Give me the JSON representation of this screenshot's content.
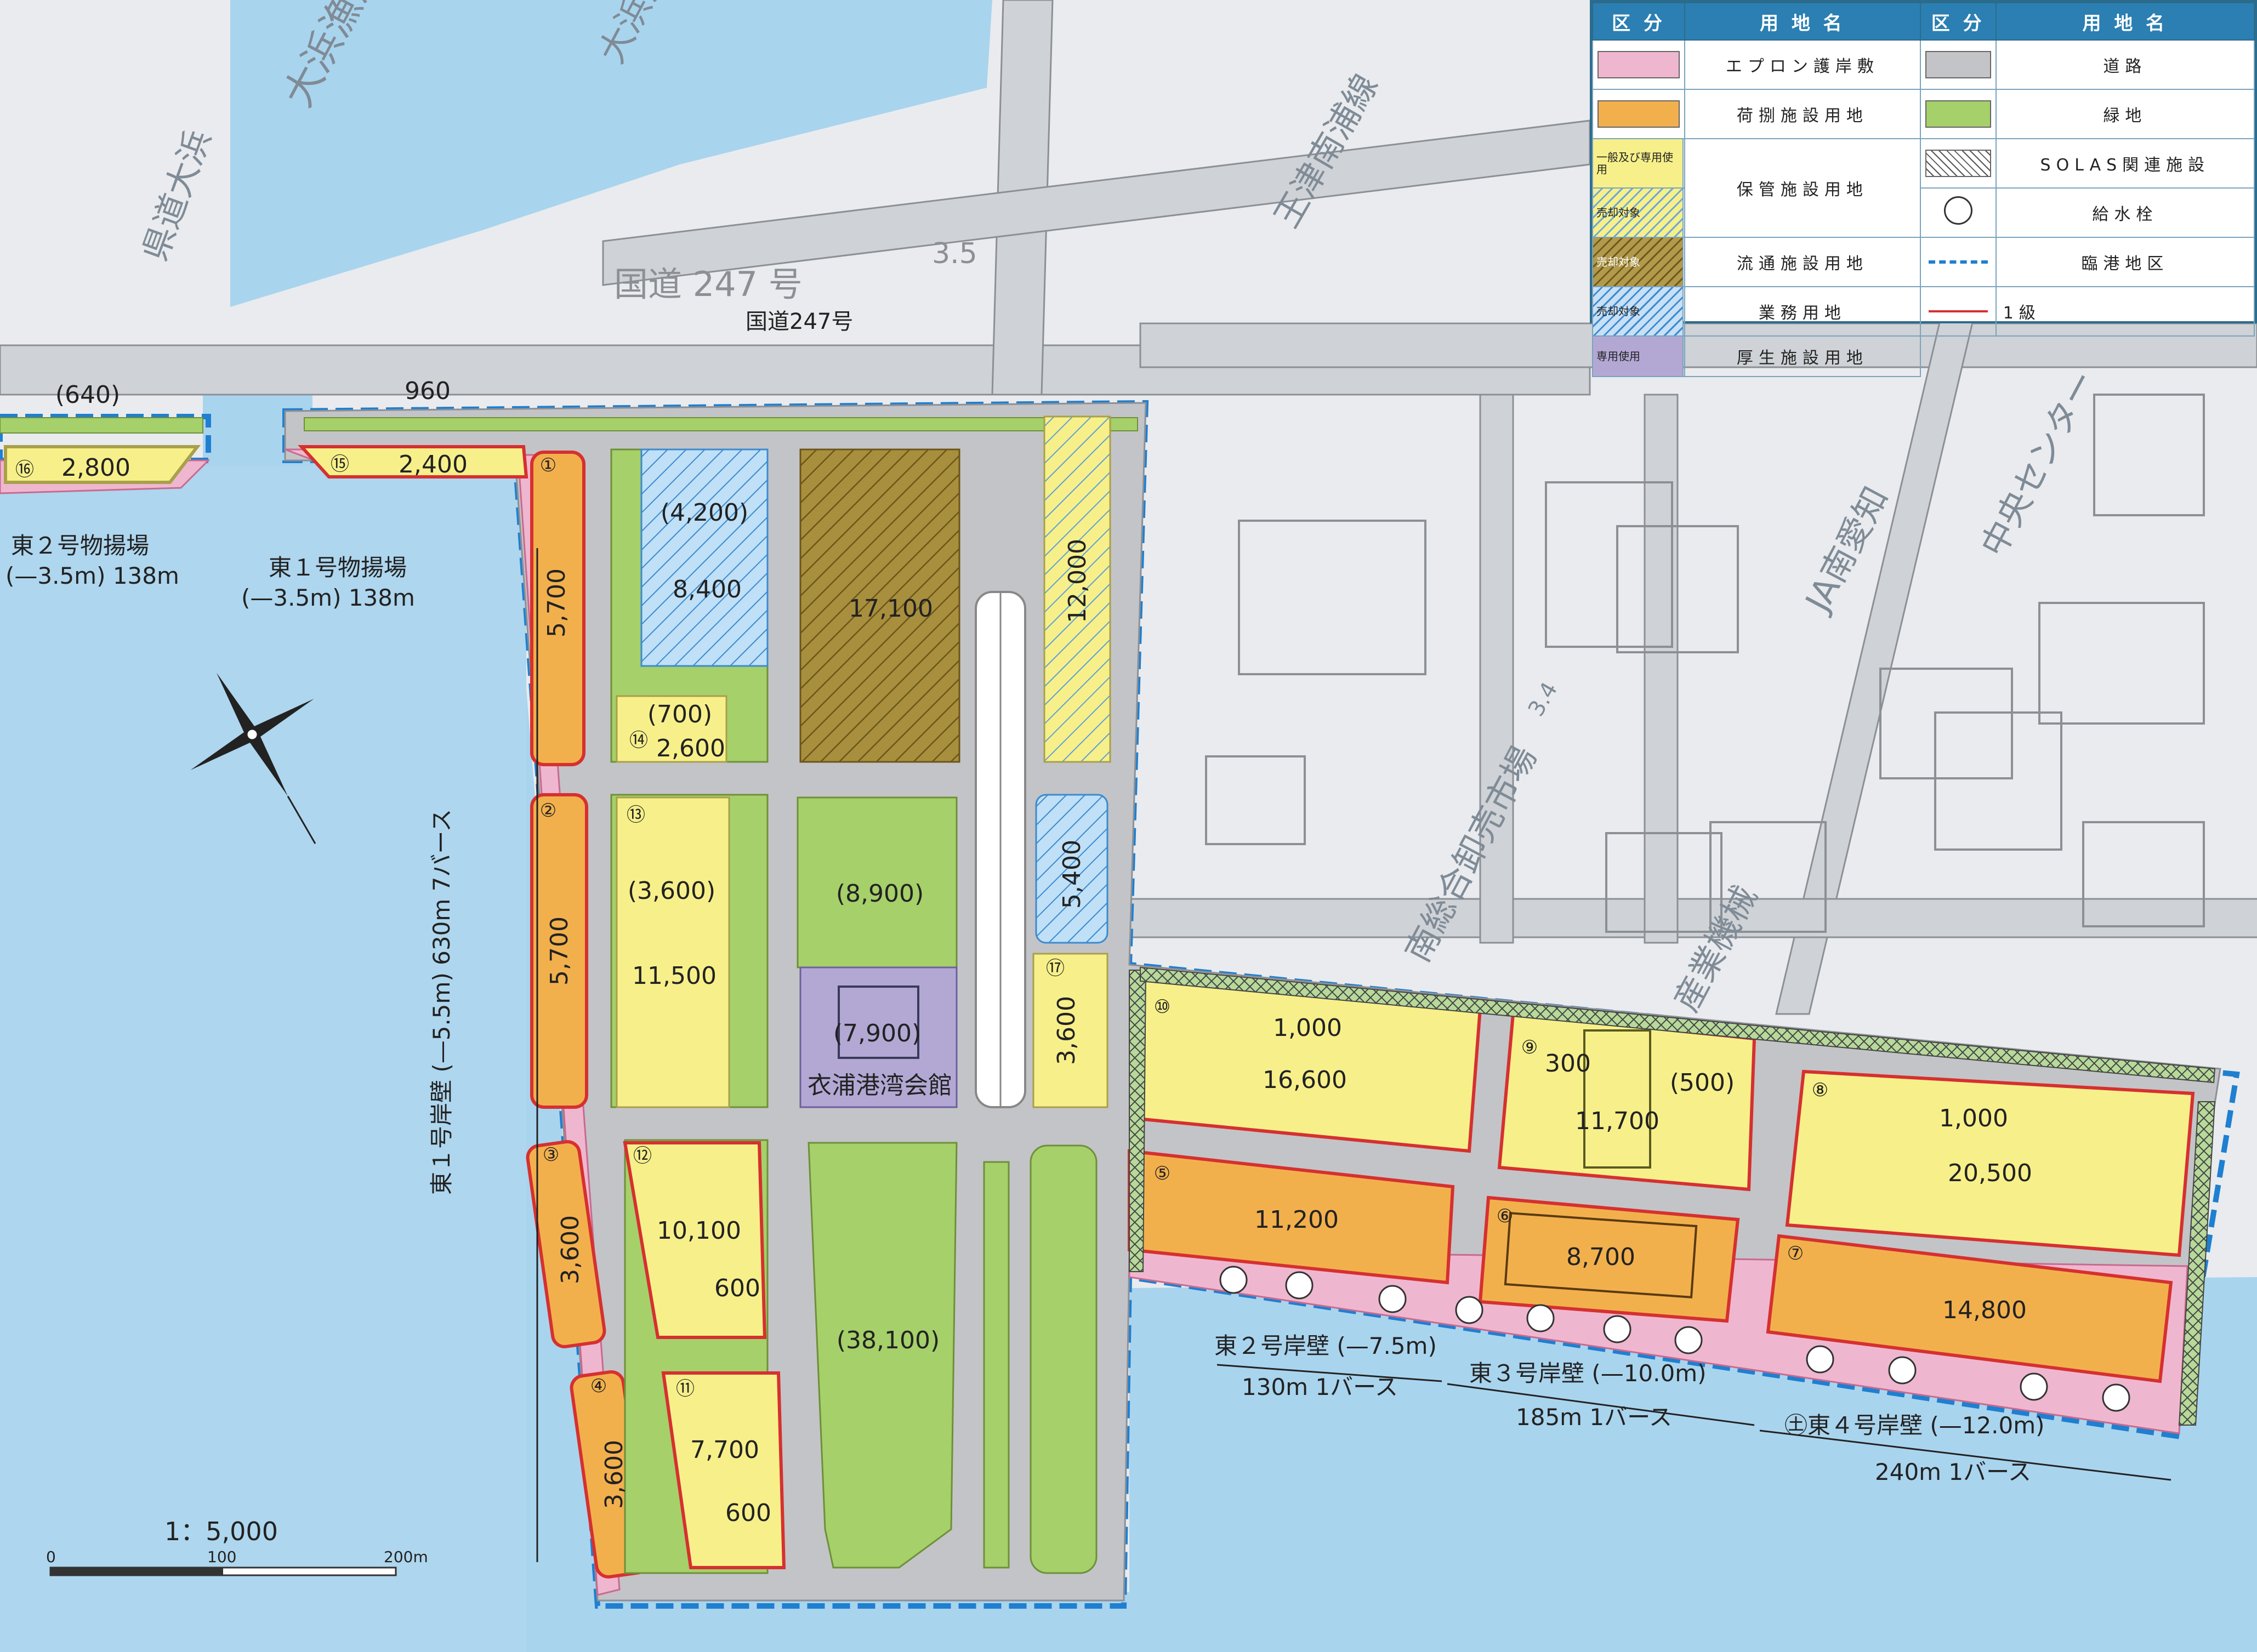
{
  "map": {
    "road_label": "国道247号",
    "road_label_base": "国道 247 号",
    "road_number_base": "3.5",
    "base_labels": [
      "大浜漁港",
      "大浜漁協",
      "県道大浜",
      "王津南浦線",
      "南総合卸売市場",
      "JA南愛知",
      "中央センター",
      "産業機械",
      "3.4"
    ],
    "scale_title": "1：5,000",
    "scale_ticks": [
      "0",
      "100",
      "200m"
    ],
    "colors": {
      "sea": "#a9d4ee",
      "base": "#e9ebee",
      "road": "#c3c4c7",
      "apron": "#efb7cf",
      "cargo": "#f2b04d",
      "storage": "#f7f08a",
      "green": "#a5d06a",
      "welfare": "#b3a8d4",
      "harbor_line": "#1f7fd0",
      "boundary": "#d63030"
    },
    "plot_labels": [
      {
        "num": "⑯",
        "value": "2,800"
      },
      {
        "num": "⑮",
        "value": "2,400"
      },
      {
        "num": "",
        "value": "(640)"
      },
      {
        "num": "",
        "value": "960"
      },
      {
        "num": "①",
        "value": "5,700"
      },
      {
        "num": "②",
        "value": "5,700"
      },
      {
        "num": "③",
        "value": "3,600"
      },
      {
        "num": "④",
        "value": "3,600"
      },
      {
        "num": "",
        "value": "(4,200)"
      },
      {
        "num": "",
        "value": "8,400"
      },
      {
        "num": "",
        "value": "17,100"
      },
      {
        "num": "",
        "value": "12,000"
      },
      {
        "num": "⑭",
        "value": "(700)"
      },
      {
        "num": "",
        "value": "2,600"
      },
      {
        "num": "⑬",
        "value": "(3,600)"
      },
      {
        "num": "",
        "value": "11,500"
      },
      {
        "num": "",
        "value": "(8,900)"
      },
      {
        "num": "",
        "value": "5,400"
      },
      {
        "num": "",
        "value": "(7,900)"
      },
      {
        "num": "⑰",
        "value": "3,600"
      },
      {
        "num": "⑫",
        "value": "10,100"
      },
      {
        "num": "",
        "value": "600"
      },
      {
        "num": "",
        "value": "(38,100)"
      },
      {
        "num": "⑪",
        "value": "7,700"
      },
      {
        "num": "",
        "value": "600"
      },
      {
        "num": "⑩",
        "value": "1,000"
      },
      {
        "num": "",
        "value": "16,600"
      },
      {
        "num": "⑨",
        "value": "300"
      },
      {
        "num": "",
        "value": "(500)"
      },
      {
        "num": "",
        "value": "11,700"
      },
      {
        "num": "⑧",
        "value": "1,000"
      },
      {
        "num": "",
        "value": "20,500"
      },
      {
        "num": "⑤",
        "value": "11,200"
      },
      {
        "num": "⑥",
        "value": "8,700"
      },
      {
        "num": "⑦",
        "value": "14,800"
      }
    ],
    "building_name": "衣浦港湾会館",
    "quay_labels": [
      "東２号物揚場",
      "(—3.5m) 138m",
      "東１号物揚場",
      "(—3.5m) 138m",
      "東１号岸壁 (—5.5m) 630m 7バース",
      "東２号岸壁 (—7.5m)",
      "130m 1バース",
      "東３号岸壁 (—10.0m)",
      "185m 1バース",
      "㊏東４号岸壁 (—12.0m)",
      "240m 1バース"
    ]
  },
  "legend": {
    "headers": [
      "区 分",
      "用 地 名",
      "区 分",
      "用 地 名"
    ],
    "left_rows": [
      {
        "sub": "",
        "name": "エプロン護岸敷",
        "swatch": "#efb7cf"
      },
      {
        "sub": "",
        "name": "荷捌施設用地",
        "swatch": "#f2b04d"
      },
      {
        "sub": "一般及び専用使用",
        "name": "保管施設用地",
        "swatch": "#f7f08a"
      },
      {
        "sub": "売却対象",
        "name": "",
        "swatch": "hatch-y"
      },
      {
        "sub": "売却対象",
        "name": "流通施設用地",
        "swatch": "hatch-b"
      },
      {
        "sub": "売却対象",
        "name": "業務用地",
        "swatch": "hatch-s"
      },
      {
        "sub": "専用使用",
        "name": "厚生施設用地",
        "swatch": "#b3a8d4"
      }
    ],
    "right_rows": [
      {
        "name": "道路",
        "swatch": "#c3c4c7"
      },
      {
        "name": "緑地",
        "swatch": "#a5d06a"
      },
      {
        "name": "SOLAS関連施設",
        "swatch": "hatch-x"
      },
      {
        "name": "給水栓",
        "swatch": "circle"
      },
      {
        "name": "臨港地区",
        "swatch": "dash"
      },
      {
        "name": "1級",
        "swatch": "line"
      }
    ]
  }
}
